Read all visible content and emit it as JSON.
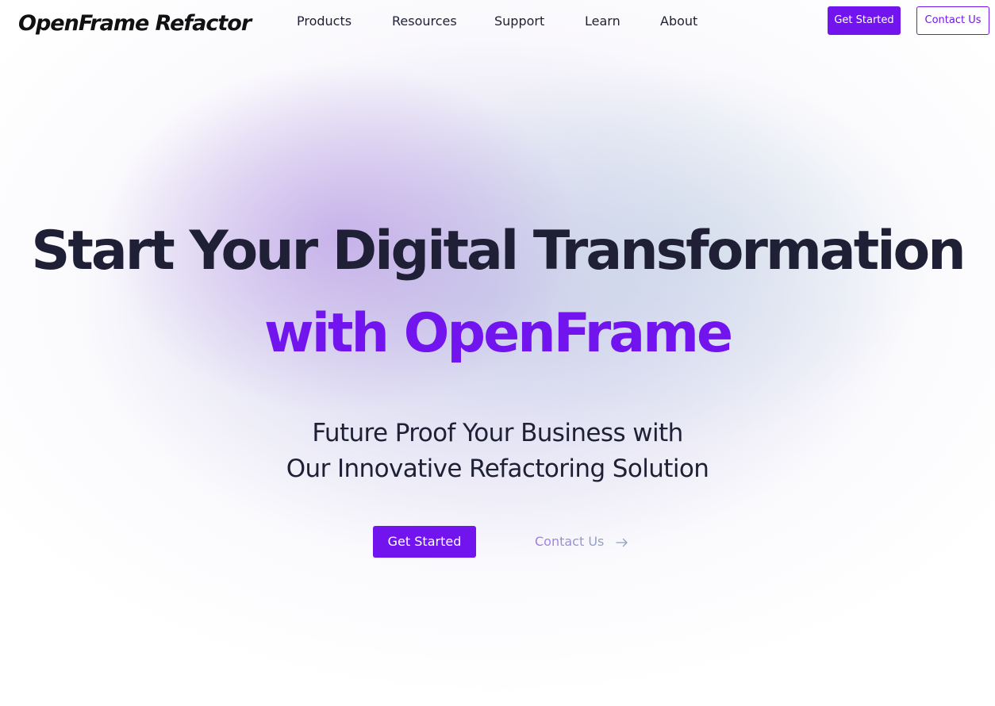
{
  "header": {
    "logo": "OpenFrame Refactor",
    "nav": [
      {
        "label": "Products"
      },
      {
        "label": "Resources"
      },
      {
        "label": "Support"
      },
      {
        "label": "Learn"
      },
      {
        "label": "About"
      }
    ],
    "get_started_label": "Get Started",
    "contact_label": "Contact Us"
  },
  "hero": {
    "title_line1": "Start Your Digital Transformation",
    "title_line2": "with OpenFrame",
    "subtitle_line1": "Future Proof Your Business with",
    "subtitle_line2": "Our Innovative Refactoring Solution",
    "primary_cta": "Get Started",
    "secondary_cta": "Contact Us",
    "secondary_cta_icon": "arrow-right-icon"
  },
  "colors": {
    "accent": "#7214ee",
    "text": "#1f2035",
    "link_gradient_start": "#a47ae0",
    "link_gradient_end": "#8fa2c4"
  }
}
